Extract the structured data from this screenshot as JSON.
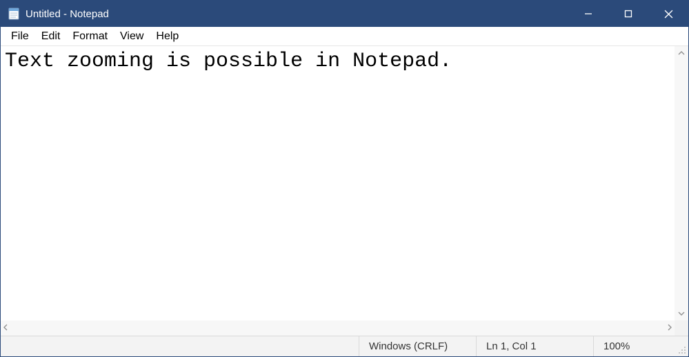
{
  "titlebar": {
    "title": "Untitled - Notepad"
  },
  "menu": {
    "items": [
      "File",
      "Edit",
      "Format",
      "View",
      "Help"
    ]
  },
  "editor": {
    "content": "Text zooming is possible in Notepad."
  },
  "statusbar": {
    "line_ending": "Windows (CRLF)",
    "cursor": "Ln 1, Col 1",
    "zoom": "100%"
  }
}
